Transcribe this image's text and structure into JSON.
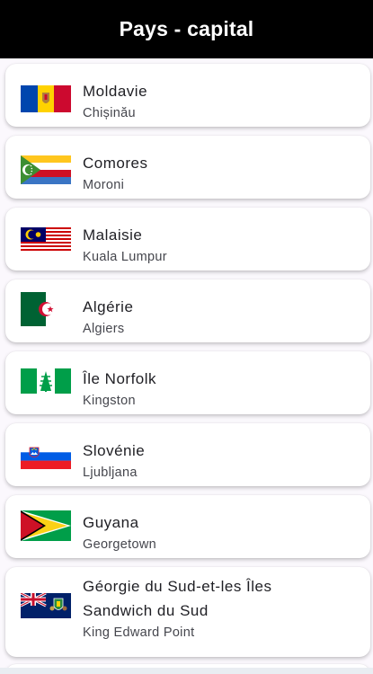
{
  "appbar": {
    "title": "Pays - capital"
  },
  "countries": [
    {
      "name": "Moldavie",
      "capital": "Chișinău",
      "flag_icon": "moldova-flag-icon"
    },
    {
      "name": "Comores",
      "capital": "Moroni",
      "flag_icon": "comoros-flag-icon"
    },
    {
      "name": "Malaisie",
      "capital": "Kuala Lumpur",
      "flag_icon": "malaysia-flag-icon"
    },
    {
      "name": "Algérie",
      "capital": "Algiers",
      "flag_icon": "algeria-flag-icon"
    },
    {
      "name": "Île Norfolk",
      "capital": "Kingston",
      "flag_icon": "norfolk-island-flag-icon"
    },
    {
      "name": "Slovénie",
      "capital": "Ljubljana",
      "flag_icon": "slovenia-flag-icon"
    },
    {
      "name": "Guyana",
      "capital": "Georgetown",
      "flag_icon": "guyana-flag-icon"
    },
    {
      "name_line1": "Géorgie du Sud-et-les Îles",
      "name_line2": "Sandwich du Sud",
      "capital": "King Edward Point",
      "flag_icon": "south-georgia-flag-icon"
    }
  ],
  "colors": {
    "appbar_bg": "#000000",
    "appbar_text": "#ffffff",
    "card_bg": "#ffffff",
    "list_bg": "#fbf8fd"
  }
}
